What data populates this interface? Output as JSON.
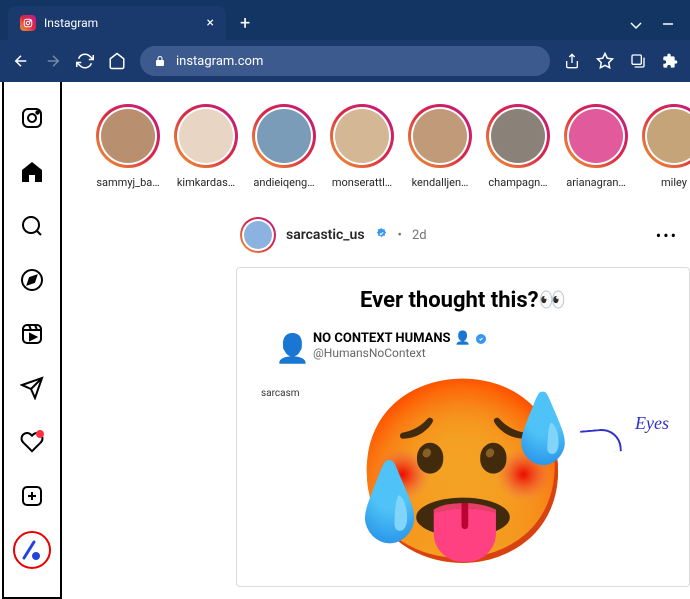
{
  "browser": {
    "tab_title": "Instagram",
    "url": "instagram.com"
  },
  "stories": [
    {
      "name": "sammyj_ba…",
      "bg": "#b89070"
    },
    {
      "name": "kimkardas…",
      "bg": "#e8d5c4"
    },
    {
      "name": "andieiqeng…",
      "bg": "#7a9cb8"
    },
    {
      "name": "monserattl…",
      "bg": "#d4b896"
    },
    {
      "name": "kendalljen…",
      "bg": "#c19a7a"
    },
    {
      "name": "champagn…",
      "bg": "#8a8278"
    },
    {
      "name": "arianagran…",
      "bg": "#e05a9c"
    },
    {
      "name": "miley",
      "bg": "#c4a478"
    }
  ],
  "post": {
    "username": "sarcastic_us",
    "time_sep": "•",
    "time": "2d",
    "body_title": "Ever thought this?👀",
    "tweet_user": "NO CONTEXT HUMANS",
    "tweet_emoji": "👤",
    "tweet_handle": "@HumansNoContext",
    "sarcasm_label": "sarcasm",
    "annotation_eyes": "Eyes"
  }
}
